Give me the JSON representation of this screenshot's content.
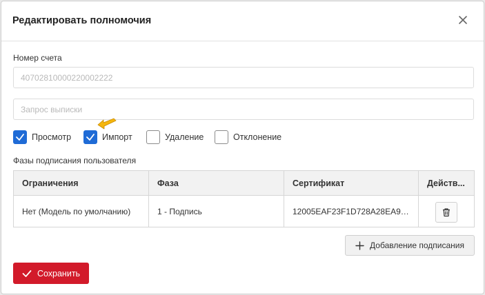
{
  "dialog": {
    "title": "Редактировать полномочия",
    "close_icon": "close-icon"
  },
  "account": {
    "label": "Номер счета",
    "value": "40702810000220002222"
  },
  "statement": {
    "placeholder": "Запрос выписки"
  },
  "permissions": [
    {
      "label": "Просмотр",
      "checked": true
    },
    {
      "label": "Импорт",
      "checked": true
    },
    {
      "label": "Удаление",
      "checked": false
    },
    {
      "label": "Отклонение",
      "checked": false
    }
  ],
  "phases": {
    "section_label": "Фазы подписания пользователя",
    "columns": [
      "Ограничения",
      "Фаза",
      "Сертификат",
      "Действ..."
    ],
    "rows": [
      {
        "restriction": "Нет (Модель по умолчанию)",
        "phase": "1 - Подпись",
        "certificate": "12005EAF23F1D728A28EA9E3..."
      }
    ]
  },
  "buttons": {
    "add_signing": "Добавление подписания",
    "save": "Сохранить"
  },
  "colors": {
    "primary": "#1f6bd6",
    "danger": "#d21a2a",
    "pointer": "#f5b60d"
  }
}
